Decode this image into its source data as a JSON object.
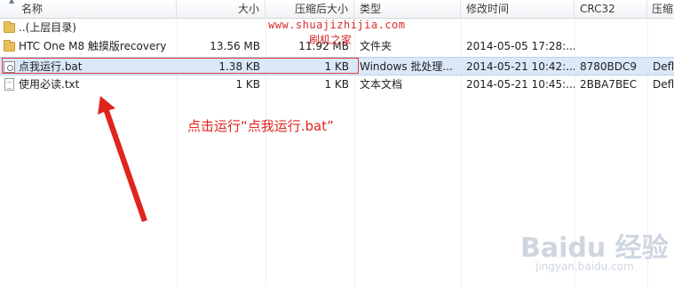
{
  "columns": [
    "名称",
    "大小",
    "压缩后大小",
    "类型",
    "修改时间",
    "CRC32",
    "压缩"
  ],
  "rows": [
    {
      "name": "..(上层目录)",
      "size": "",
      "packed": "",
      "type": "",
      "modified": "",
      "crc": "",
      "method": "",
      "icon": "folder-icon"
    },
    {
      "name": "HTC One M8 触摸版recovery",
      "size": "13.56 MB",
      "packed": "11.92 MB",
      "type": "文件夹",
      "modified": "2014-05-05 17:28:...",
      "crc": "",
      "method": "",
      "icon": "folder-icon"
    },
    {
      "name": "点我运行.bat",
      "size": "1.38 KB",
      "packed": "1 KB",
      "type": "Windows 批处理...",
      "modified": "2014-05-21 10:42:...",
      "crc": "8780BDC9",
      "method": "Defl",
      "icon": "batch-file-icon"
    },
    {
      "name": "使用必读.txt",
      "size": "1 KB",
      "packed": "1 KB",
      "type": "文本文档",
      "modified": "2014-05-21 10:45:...",
      "crc": "2BBA7BEC",
      "method": "Defl",
      "icon": "text-file-icon"
    }
  ],
  "watermark": {
    "url": "www.shuajizhijia.com",
    "site": "刷机之家"
  },
  "annotation": "点击运行“点我运行.bat”",
  "baidu_watermark": {
    "logo": "Baidu 经验",
    "url": "jingyan.baidu.com"
  },
  "colors": {
    "annotation": "#e0241e",
    "selection": "#dbe8f8",
    "highlight_box": "#e23b3b"
  }
}
